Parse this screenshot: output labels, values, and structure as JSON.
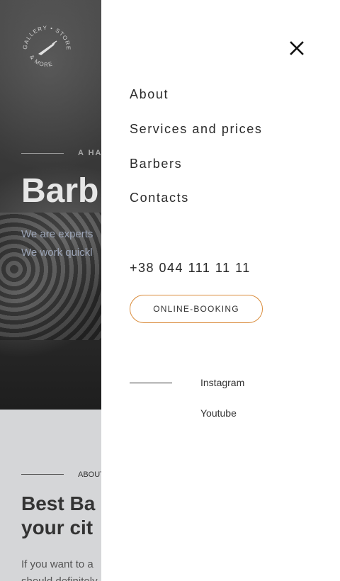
{
  "logo": {
    "text_top": "GALLERY • STORE",
    "text_bottom": "& MORE",
    "icon": "razor-icon"
  },
  "hero": {
    "kicker": "A HA",
    "title": "Barb",
    "text_line1": "We are experts",
    "text_line2": "We work quickl"
  },
  "about": {
    "kicker": "ABOUT",
    "title_line1": "Best Ba",
    "title_line2": "your cit",
    "text_line1": "If you want to a",
    "text_line2": "should definitely"
  },
  "menu": {
    "close_icon": "close-icon",
    "items": [
      {
        "label": "About"
      },
      {
        "label": "Services and prices"
      },
      {
        "label": "Barbers"
      },
      {
        "label": "Contacts"
      }
    ],
    "phone": "+38 044 111 11 11",
    "booking_label": "ONLINE-BOOKING",
    "social": [
      {
        "label": "Instagram"
      },
      {
        "label": "Youtube"
      }
    ],
    "accent_color": "#d98b3a"
  }
}
